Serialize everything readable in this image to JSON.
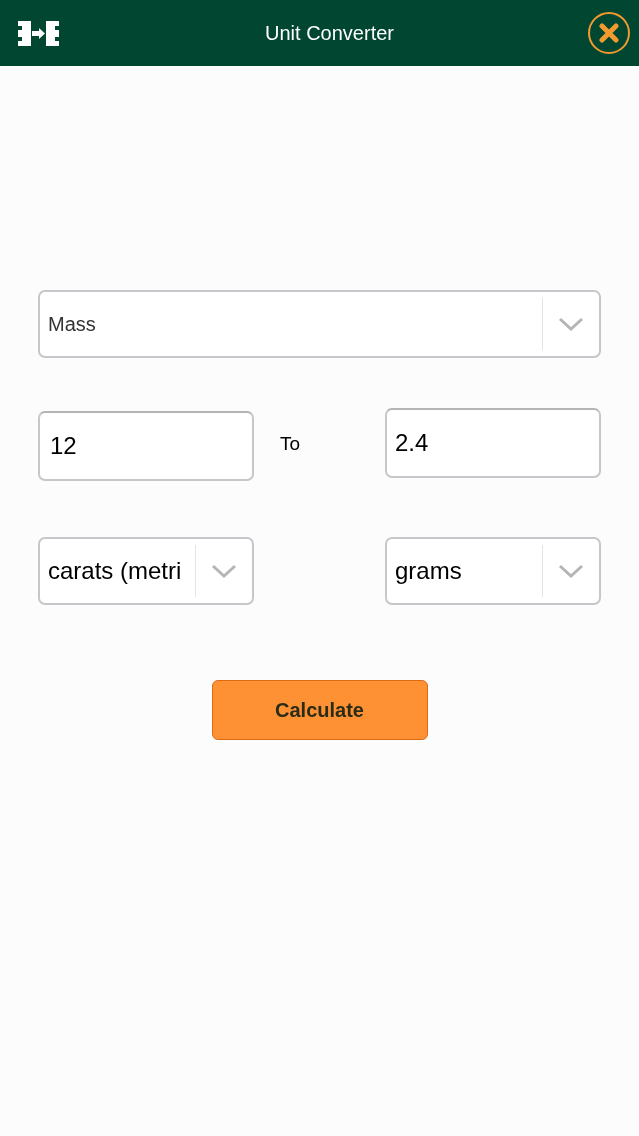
{
  "header": {
    "title": "Unit Converter"
  },
  "category_select": {
    "value": "Mass"
  },
  "from_input": {
    "value": "12"
  },
  "separator": "To",
  "to_input": {
    "value": "2.4"
  },
  "from_unit_select": {
    "value": "carats (metri"
  },
  "to_unit_select": {
    "value": "grams"
  },
  "calculate_button": {
    "label": "Calculate"
  }
}
